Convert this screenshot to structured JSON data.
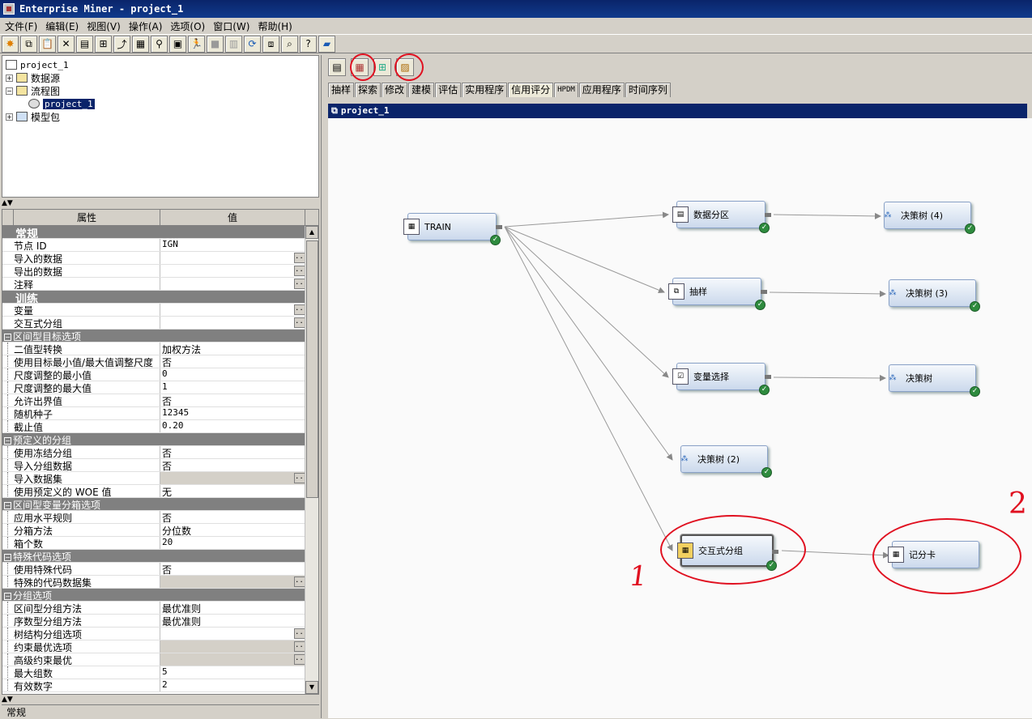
{
  "window": {
    "title": "Enterprise Miner - project_1"
  },
  "menu": [
    "文件(F)",
    "编辑(E)",
    "视图(V)",
    "操作(A)",
    "选项(O)",
    "窗口(W)",
    "帮助(H)"
  ],
  "tree": {
    "root": "project_1",
    "items": [
      "数据源",
      "流程图",
      "project_1",
      "模型包"
    ]
  },
  "properties": {
    "header_name": "属性",
    "header_value": "值",
    "rows": [
      {
        "kind": "section",
        "name": "常规"
      },
      {
        "kind": "row",
        "name": "节点 ID",
        "value": "IGN"
      },
      {
        "kind": "row",
        "name": "导入的数据",
        "value": "",
        "btn": true
      },
      {
        "kind": "row",
        "name": "导出的数据",
        "value": "",
        "btn": true
      },
      {
        "kind": "row",
        "name": "注释",
        "value": "",
        "btn": true
      },
      {
        "kind": "section",
        "name": "训练"
      },
      {
        "kind": "row",
        "name": "变量",
        "value": "",
        "btn": true
      },
      {
        "kind": "row",
        "name": "交互式分组",
        "value": "",
        "btn": true
      },
      {
        "kind": "group",
        "name": "区间型目标选项"
      },
      {
        "kind": "child",
        "name": "二值型转换",
        "value": "加权方法",
        "cn": true
      },
      {
        "kind": "child",
        "name": "使用目标最小值/最大值调整尺度",
        "value": "否",
        "cn": true
      },
      {
        "kind": "child",
        "name": "尺度调整的最小值",
        "value": "0"
      },
      {
        "kind": "child",
        "name": "尺度调整的最大值",
        "value": "1"
      },
      {
        "kind": "child",
        "name": "允许出界值",
        "value": "否",
        "cn": true
      },
      {
        "kind": "child",
        "name": "随机种子",
        "value": "12345"
      },
      {
        "kind": "child",
        "name": "截止值",
        "value": "0.20"
      },
      {
        "kind": "group",
        "name": "预定义的分组"
      },
      {
        "kind": "child",
        "name": "使用冻结分组",
        "value": "否",
        "cn": true
      },
      {
        "kind": "child",
        "name": "导入分组数据",
        "value": "否",
        "cn": true
      },
      {
        "kind": "child",
        "name": "导入数据集",
        "value": "",
        "btn": true,
        "gray": true
      },
      {
        "kind": "child",
        "name": "使用预定义的 WOE 值",
        "value": "无",
        "cn": true
      },
      {
        "kind": "group",
        "name": "区间型变量分箱选项"
      },
      {
        "kind": "child",
        "name": "应用水平规则",
        "value": "否",
        "cn": true
      },
      {
        "kind": "child",
        "name": "分箱方法",
        "value": "分位数",
        "cn": true
      },
      {
        "kind": "child",
        "name": "箱个数",
        "value": "20"
      },
      {
        "kind": "group",
        "name": "特殊代码选项"
      },
      {
        "kind": "child",
        "name": "使用特殊代码",
        "value": "否",
        "cn": true
      },
      {
        "kind": "child",
        "name": "特殊的代码数据集",
        "value": "",
        "btn": true,
        "gray": true
      },
      {
        "kind": "group",
        "name": "分组选项"
      },
      {
        "kind": "child",
        "name": "区间型分组方法",
        "value": "最优准则",
        "cn": true
      },
      {
        "kind": "child",
        "name": "序数型分组方法",
        "value": "最优准则",
        "cn": true
      },
      {
        "kind": "child",
        "name": "树结构分组选项",
        "value": "",
        "btn": true
      },
      {
        "kind": "child",
        "name": "约束最优选项",
        "value": "",
        "btn": true,
        "gray": true
      },
      {
        "kind": "child",
        "name": "高级约束最优",
        "value": "",
        "btn": true,
        "gray": true
      },
      {
        "kind": "child",
        "name": "最大组数",
        "value": "5"
      },
      {
        "kind": "child",
        "name": "有效数字",
        "value": "2"
      }
    ]
  },
  "bottom_panel": {
    "label": "常规"
  },
  "tabs": [
    "抽样",
    "探索",
    "修改",
    "建模",
    "评估",
    "实用程序",
    "信用评分",
    "HPDM",
    "应用程序",
    "时间序列"
  ],
  "diagram": {
    "title": "project_1",
    "nodes": {
      "train": "TRAIN",
      "partition": "数据分区",
      "sample": "抽样",
      "varsel": "变量选择",
      "tree2": "决策树 (2)",
      "igroup": "交互式分组",
      "tree4": "决策树 (4)",
      "tree3": "决策树 (3)",
      "tree": "决策树",
      "scorecard": "记分卡"
    },
    "annotations": {
      "mark1": "1",
      "mark2": "2"
    }
  },
  "colors": {
    "accent": "#0a246a",
    "annotation": "#e01020",
    "success": "#2e8b3e"
  }
}
